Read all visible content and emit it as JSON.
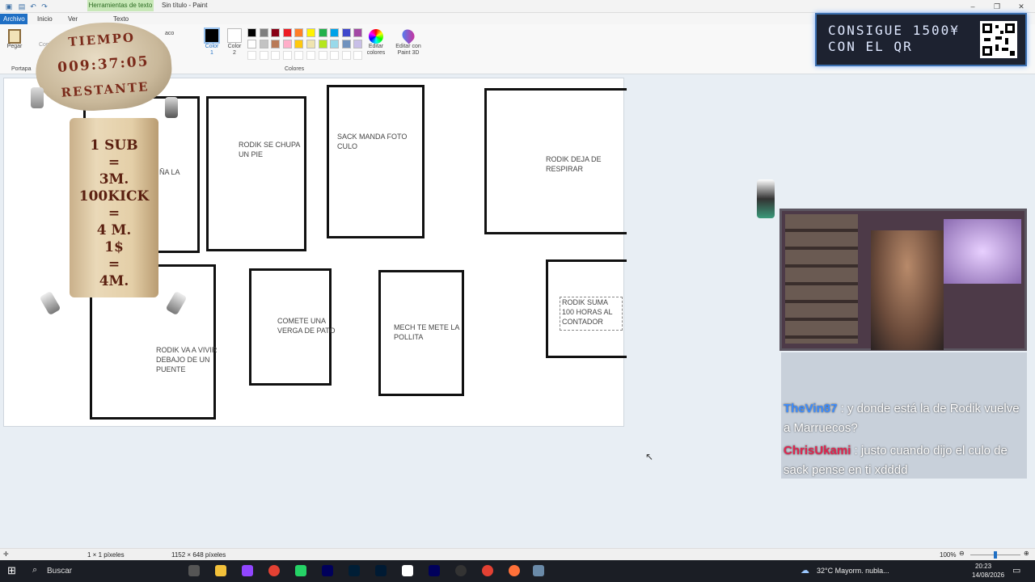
{
  "window": {
    "title": "Sin título - Paint",
    "context_tab": "Herramientas de texto",
    "context_sub": "Texto"
  },
  "tabs": [
    "Archivo",
    "Inicio",
    "Ver"
  ],
  "ribbon": {
    "paste_label": "Pegar",
    "clipboard_label": "Portapa",
    "color1_label": "Color\n1",
    "color2_label": "Color\n2",
    "colors_group": "Colores",
    "edit_colors": "Editar\ncolores",
    "paint3d": "Editar con\nPaint 3D",
    "opaco": "aco",
    "copy_label": "Copia"
  },
  "palette": [
    "#000000",
    "#7f7f7f",
    "#880015",
    "#ed1c24",
    "#ff7f27",
    "#fff200",
    "#22b14c",
    "#00a2e8",
    "#3f48cc",
    "#a349a4",
    "#ffffff",
    "#c3c3c3",
    "#b97a57",
    "#ffaec9",
    "#ffc90e",
    "#efe4b0",
    "#b5e61d",
    "#99d9ea",
    "#7092be",
    "#c8bfe7"
  ],
  "canvas_texts": {
    "b_partial": "ÑA LA",
    "b_rodik_pie": "RODIK SE CHUPA UN PIE",
    "b_sack": "SACK MANDA FOTO CULO",
    "b_respirar": "RODIK DEJA DE RESPIRAR",
    "b_puente": "RODIK VA A VIVIR DEBAJO DE UN PUENTE",
    "b_pato": "COMETE UNA VERGA DE PATO",
    "b_mech": "MECH TE METE LA POLLITA",
    "b_suma": "RODIK SUMA 100 HORAS AL CONTADOR"
  },
  "overlay": {
    "timer_l1": "TIEMPO",
    "timer_l2": "009:37:05",
    "timer_l3": "RESTANTE",
    "scroll_lines": [
      "1 SUB",
      "=",
      "3M.",
      "100KICK",
      "=",
      "4 M.",
      "1$",
      "=",
      "4M."
    ],
    "promo": "CONSIGUE 1500¥\nCON EL QR"
  },
  "chat": [
    {
      "user": "TheVin87",
      "color": "#3b8cff",
      "text": "y donde está la de Rodik vuelve a Marruecos?"
    },
    {
      "user": "ChrisUkami",
      "color": "#e0244f",
      "text": "justo cuando dijo el culo de sack pense en ti xdddd"
    }
  ],
  "status": {
    "cursor": "1 × 1 píxeles",
    "size": "1152 × 648 píxeles",
    "zoom": "100%"
  },
  "taskbar": {
    "search": "Buscar",
    "weather": "32°C  Mayorm. nubla...",
    "time": "20:23",
    "date": "14/08/2026"
  }
}
